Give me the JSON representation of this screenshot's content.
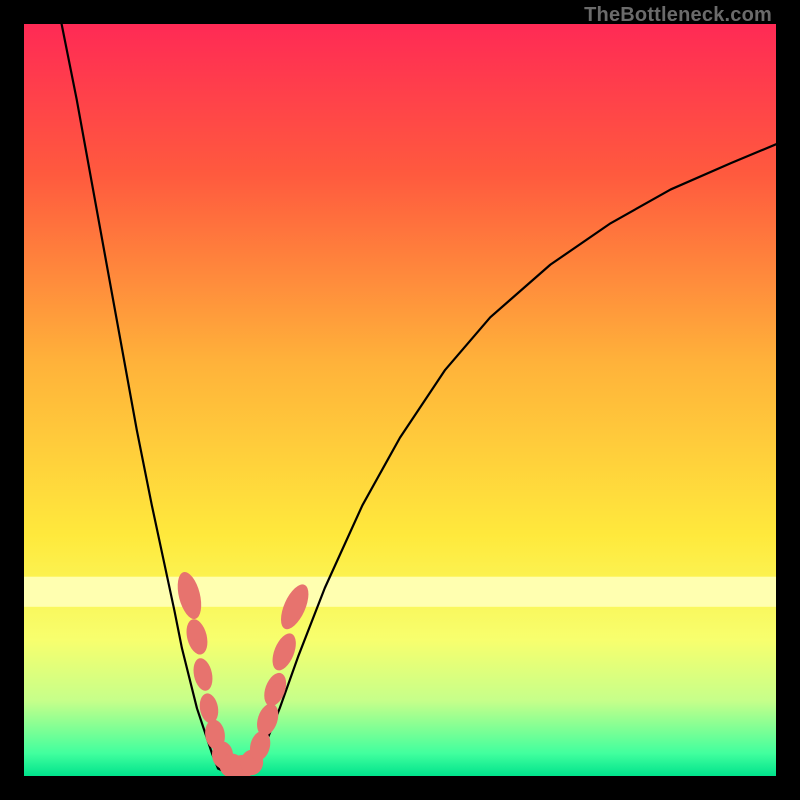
{
  "watermark": "TheBottleneck.com",
  "chart_data": {
    "type": "line",
    "title": "",
    "xlabel": "",
    "ylabel": "",
    "xlim": [
      0,
      100
    ],
    "ylim": [
      0,
      100
    ],
    "grid": false,
    "legend": false,
    "background_gradient": {
      "stops": [
        {
          "offset": 0.0,
          "color": "#ff2a55"
        },
        {
          "offset": 0.2,
          "color": "#ff5a3e"
        },
        {
          "offset": 0.45,
          "color": "#ffb23a"
        },
        {
          "offset": 0.68,
          "color": "#ffe93c"
        },
        {
          "offset": 0.82,
          "color": "#f7ff6e"
        },
        {
          "offset": 0.9,
          "color": "#c6ff8a"
        },
        {
          "offset": 0.97,
          "color": "#41ff9e"
        },
        {
          "offset": 1.0,
          "color": "#00e38c"
        }
      ]
    },
    "notch_band": {
      "y_top": 73,
      "y_bottom": 77,
      "color": "#ffffb0"
    },
    "series": [
      {
        "name": "left-curve",
        "x": [
          5.0,
          7.0,
          9.0,
          11.0,
          13.0,
          15.0,
          17.0,
          18.5,
          20.0,
          21.0,
          22.0,
          23.0,
          24.0,
          25.0,
          25.8
        ],
        "y": [
          100,
          90,
          79,
          68,
          57,
          46,
          36,
          29,
          22,
          17,
          13,
          9,
          6,
          3,
          1
        ],
        "stroke": "#000000",
        "stroke_width": 2.2
      },
      {
        "name": "valley-floor",
        "x": [
          25.8,
          27.0,
          28.2,
          29.5,
          30.5
        ],
        "y": [
          1,
          0.4,
          0.3,
          0.5,
          1
        ],
        "stroke": "#000000",
        "stroke_width": 2.2
      },
      {
        "name": "right-curve",
        "x": [
          30.5,
          32.0,
          34.0,
          36.5,
          40.0,
          45.0,
          50.0,
          56.0,
          62.0,
          70.0,
          78.0,
          86.0,
          94.0,
          100.0
        ],
        "y": [
          1,
          4,
          9,
          16,
          25,
          36,
          45,
          54,
          61,
          68,
          73.5,
          78,
          81.5,
          84
        ],
        "stroke": "#000000",
        "stroke_width": 2.2
      }
    ],
    "blobs": {
      "color": "#e7736e",
      "items": [
        {
          "cx": 22.0,
          "cy": 24.0,
          "rx": 1.4,
          "ry": 3.2,
          "rot": -14
        },
        {
          "cx": 23.0,
          "cy": 18.5,
          "rx": 1.3,
          "ry": 2.4,
          "rot": -14
        },
        {
          "cx": 23.8,
          "cy": 13.5,
          "rx": 1.2,
          "ry": 2.2,
          "rot": -12
        },
        {
          "cx": 24.6,
          "cy": 9.0,
          "rx": 1.2,
          "ry": 2.0,
          "rot": -10
        },
        {
          "cx": 25.4,
          "cy": 5.5,
          "rx": 1.3,
          "ry": 2.0,
          "rot": -8
        },
        {
          "cx": 26.4,
          "cy": 2.8,
          "rx": 1.4,
          "ry": 1.8,
          "rot": -4
        },
        {
          "cx": 27.6,
          "cy": 1.4,
          "rx": 1.6,
          "ry": 1.6,
          "rot": 0
        },
        {
          "cx": 29.0,
          "cy": 1.2,
          "rx": 1.6,
          "ry": 1.6,
          "rot": 0
        },
        {
          "cx": 30.3,
          "cy": 1.8,
          "rx": 1.5,
          "ry": 1.7,
          "rot": 6
        },
        {
          "cx": 31.4,
          "cy": 4.0,
          "rx": 1.3,
          "ry": 2.0,
          "rot": 14
        },
        {
          "cx": 32.4,
          "cy": 7.5,
          "rx": 1.3,
          "ry": 2.2,
          "rot": 18
        },
        {
          "cx": 33.4,
          "cy": 11.5,
          "rx": 1.3,
          "ry": 2.3,
          "rot": 20
        },
        {
          "cx": 34.6,
          "cy": 16.5,
          "rx": 1.3,
          "ry": 2.6,
          "rot": 22
        },
        {
          "cx": 36.0,
          "cy": 22.5,
          "rx": 1.4,
          "ry": 3.2,
          "rot": 24
        }
      ]
    }
  }
}
